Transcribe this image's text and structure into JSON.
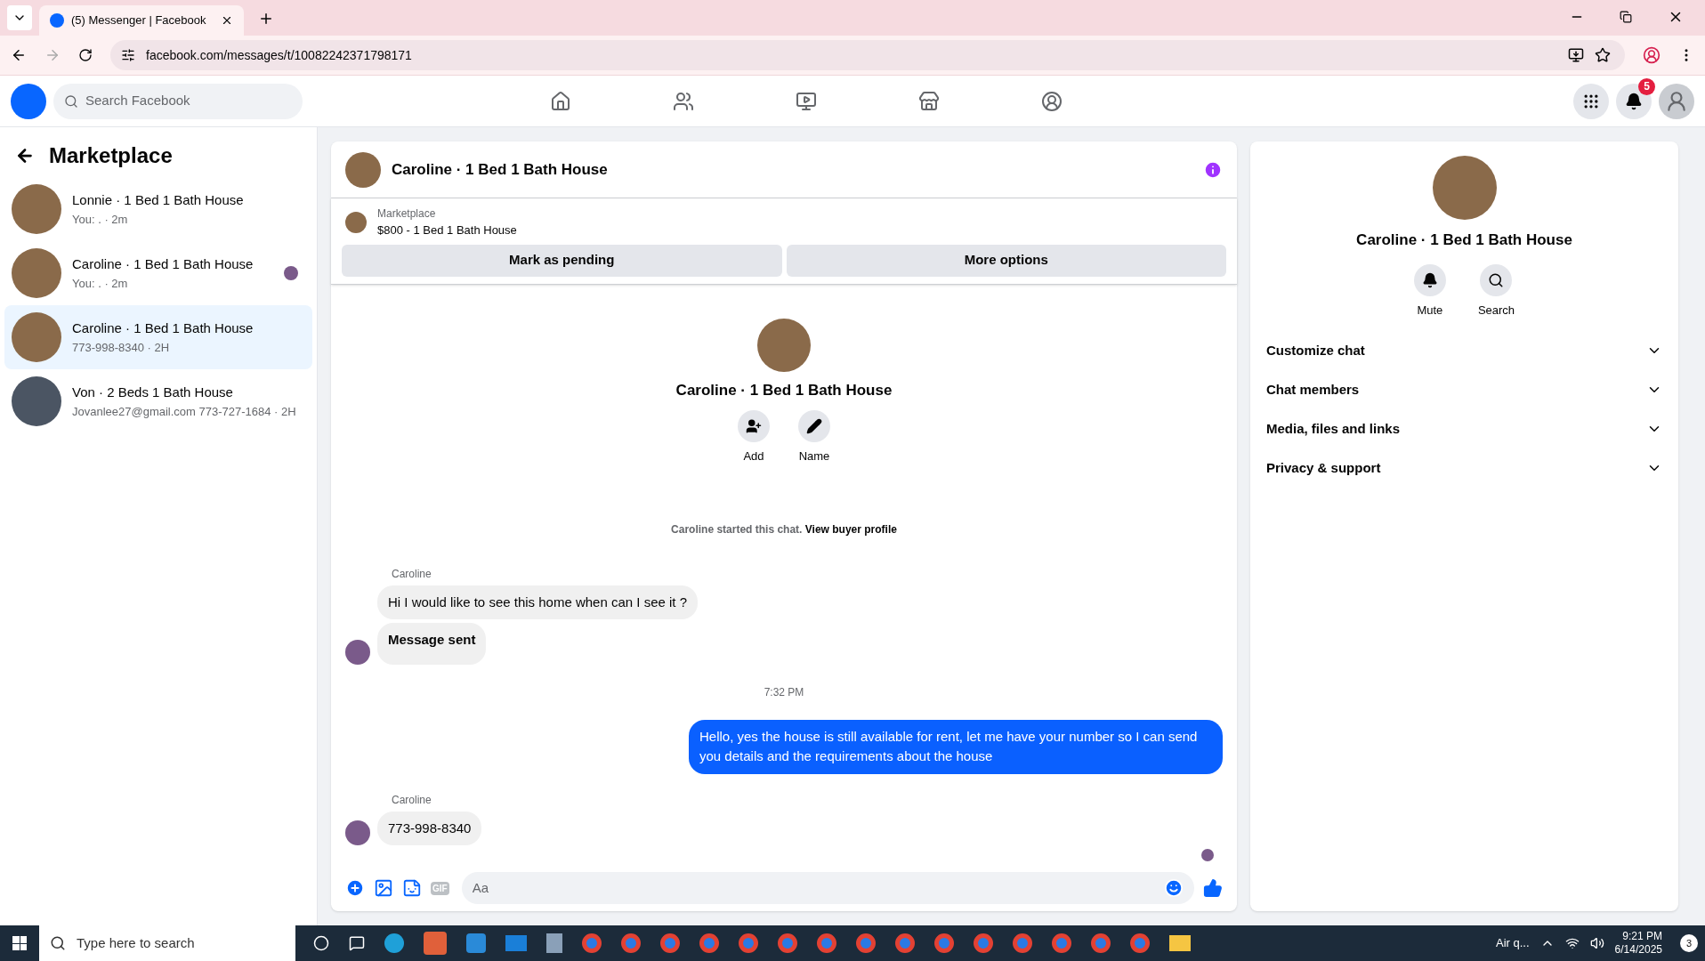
{
  "browser": {
    "tab_title": "(5) Messenger | Facebook",
    "url": "facebook.com/messages/t/10082242371798171"
  },
  "topnav": {
    "search_placeholder": "Search Facebook",
    "notifications_badge": "5",
    "nav_items": [
      {
        "kind": "home",
        "selected": false
      },
      {
        "kind": "friends",
        "selected": false
      },
      {
        "kind": "video",
        "selected": false
      },
      {
        "kind": "marketplace",
        "selected": false
      },
      {
        "kind": "groups",
        "selected": false
      }
    ]
  },
  "sidebar": {
    "title": "Marketplace",
    "conversations": [
      {
        "name": "Lonnie · 1 Bed 1 Bath House",
        "preview": "You: . · 2m",
        "selected": false,
        "read_receipt": false,
        "kind": "house"
      },
      {
        "name": "Caroline · 1 Bed 1 Bath House",
        "preview": "You: . · 2m",
        "selected": false,
        "read_receipt": true,
        "kind": "house"
      },
      {
        "name": "Caroline · 1 Bed 1 Bath House",
        "preview": "773-998-8340 · 2H",
        "selected": true,
        "read_receipt": false,
        "kind": "house"
      },
      {
        "name": "Von · 2 Beds 1 Bath House",
        "preview": "Jovanlee27@gmail.com 773-727-1684 · 2H",
        "selected": false,
        "read_receipt": false,
        "kind": "interior"
      }
    ]
  },
  "chat": {
    "title": "Caroline · 1 Bed 1 Bath House",
    "listing": {
      "label": "Marketplace",
      "title": "$800 - 1 Bed 1 Bath House"
    },
    "actions": [
      "Mark as pending",
      "More options"
    ],
    "profile": {
      "name": "Caroline · 1 Bed 1 Bath House",
      "actions": [
        {
          "kind": "add",
          "label": "Add"
        },
        {
          "kind": "name",
          "label": "Name"
        }
      ]
    },
    "started": {
      "text": "Caroline started this chat.",
      "link": "View buyer profile"
    },
    "messages": [
      {
        "kind": "sender",
        "text": "Caroline"
      },
      {
        "kind": "incoming",
        "text": "Hi I would like to see this home when can I see it ?",
        "avatar": false,
        "bold": false
      },
      {
        "kind": "incoming",
        "text": "Message sent",
        "avatar": true,
        "bold": true
      },
      {
        "kind": "time",
        "text": "7:32 PM"
      },
      {
        "kind": "outgoing",
        "text": "Hello, yes the house is still available for rent, let me have your number so I can send you details and the requirements about the house"
      },
      {
        "kind": "sender",
        "text": "Caroline"
      },
      {
        "kind": "incoming",
        "text": "773-998-8340",
        "avatar": true,
        "bold": false
      }
    ],
    "composer": {
      "placeholder": "Aa",
      "gif_label": "GIF"
    }
  },
  "details": {
    "name": "Caroline · 1 Bed 1 Bath House",
    "actions": [
      {
        "kind": "mute",
        "label": "Mute"
      },
      {
        "kind": "search",
        "label": "Search"
      }
    ],
    "sections": [
      {
        "label": "Customize chat",
        "expanded": false
      },
      {
        "label": "Chat members",
        "expanded": false
      },
      {
        "label": "Media, files and links",
        "expanded": false
      },
      {
        "label": "Privacy & support",
        "expanded": false
      }
    ]
  },
  "taskbar": {
    "search_placeholder": "Type here to search",
    "weather": "Air q...",
    "time": "9:21 PM",
    "date": "6/14/2025",
    "notification_count": "3"
  }
}
